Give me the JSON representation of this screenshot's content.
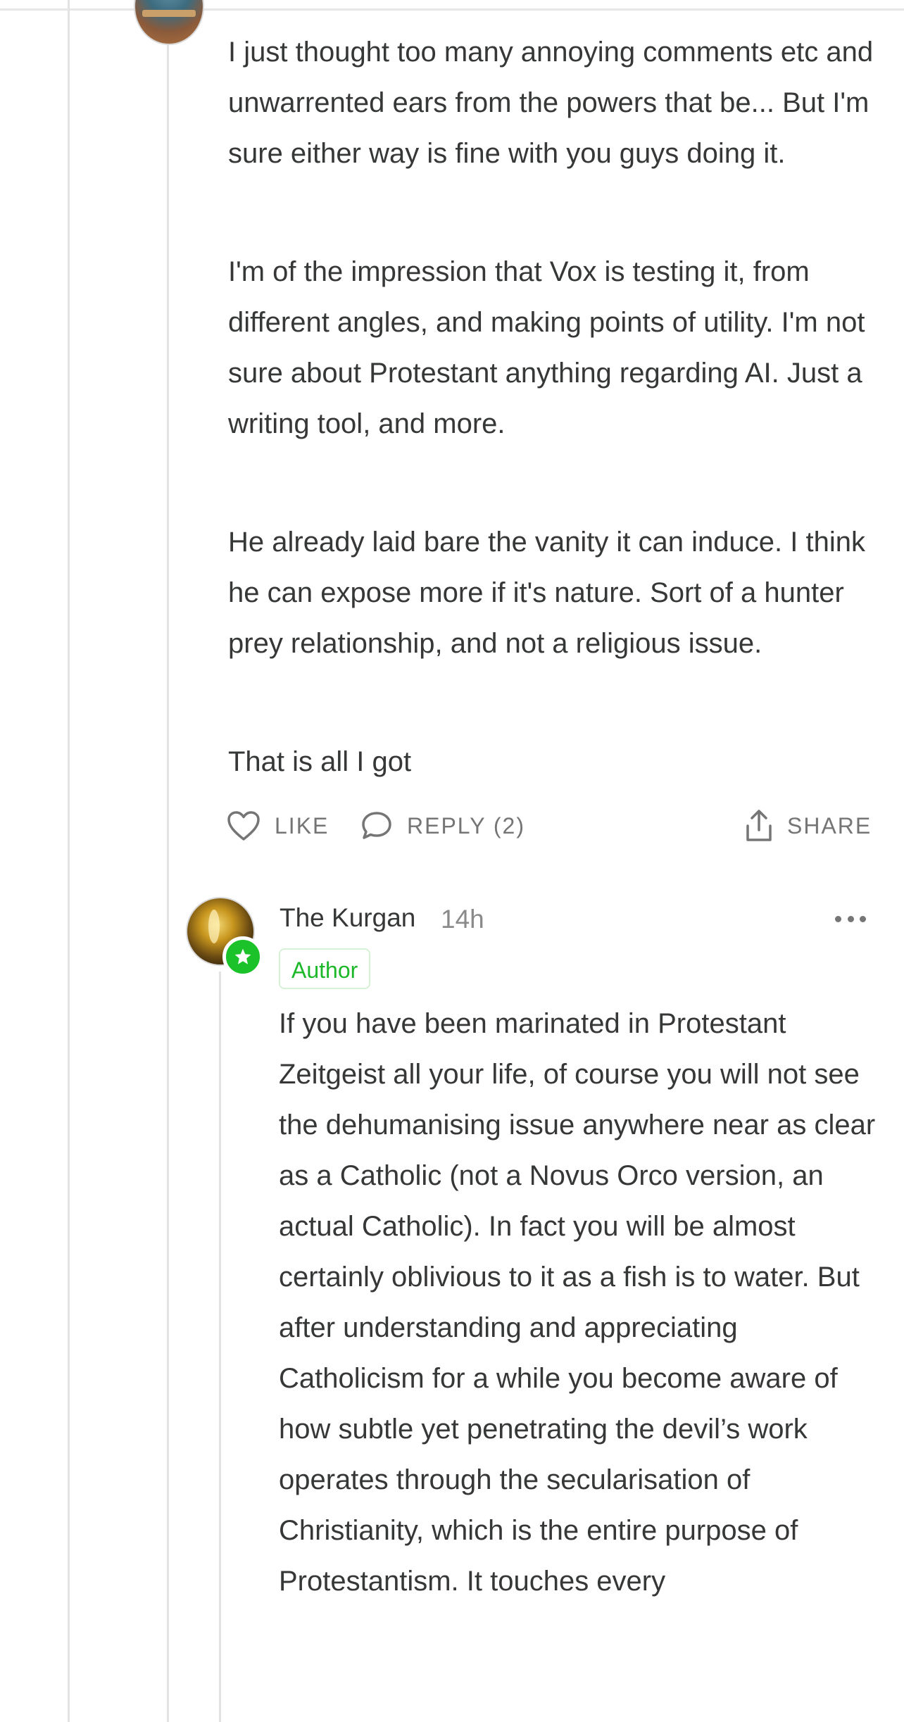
{
  "parent_comment": {
    "avatar_icon": "avatar-image",
    "paragraphs": [
      "I just thought too many annoying comments etc and unwarrented ears from the powers that be... But I'm sure either way is fine with you guys doing it.",
      "I'm of the impression that Vox is testing it, from different angles, and making points of utility. I'm not sure about Protestant anything regarding AI. Just a writing tool, and more.",
      "He already laid bare the vanity it can induce. I think he can expose more if it's nature. Sort of a hunter prey relationship, and not a religious issue.",
      "That is all I got"
    ],
    "actions": {
      "like_label": "LIKE",
      "reply_label": "REPLY (2)",
      "share_label": "SHARE"
    }
  },
  "reply_comment": {
    "author": "The Kurgan",
    "timestamp": "14h",
    "author_tag": "Author",
    "text": "If you have been marinated in Protestant Zeitgeist all your life, of course you will not see the dehumanising issue anywhere near as clear as a Catholic (not a Novus Orco version, an actual Catholic). In fact you will be almost certainly oblivious to it as a fish is to water. But after understanding and appreciating Catholicism for a while you become aware of how subtle yet penetrating the devil’s work operates through the secularisation of Christianity, which is the entire purpose of Protestantism. It touches every"
  },
  "colors": {
    "text": "#363737",
    "muted": "#757575",
    "author_green": "#1cc229",
    "thread_line": "#e3e3e3"
  }
}
